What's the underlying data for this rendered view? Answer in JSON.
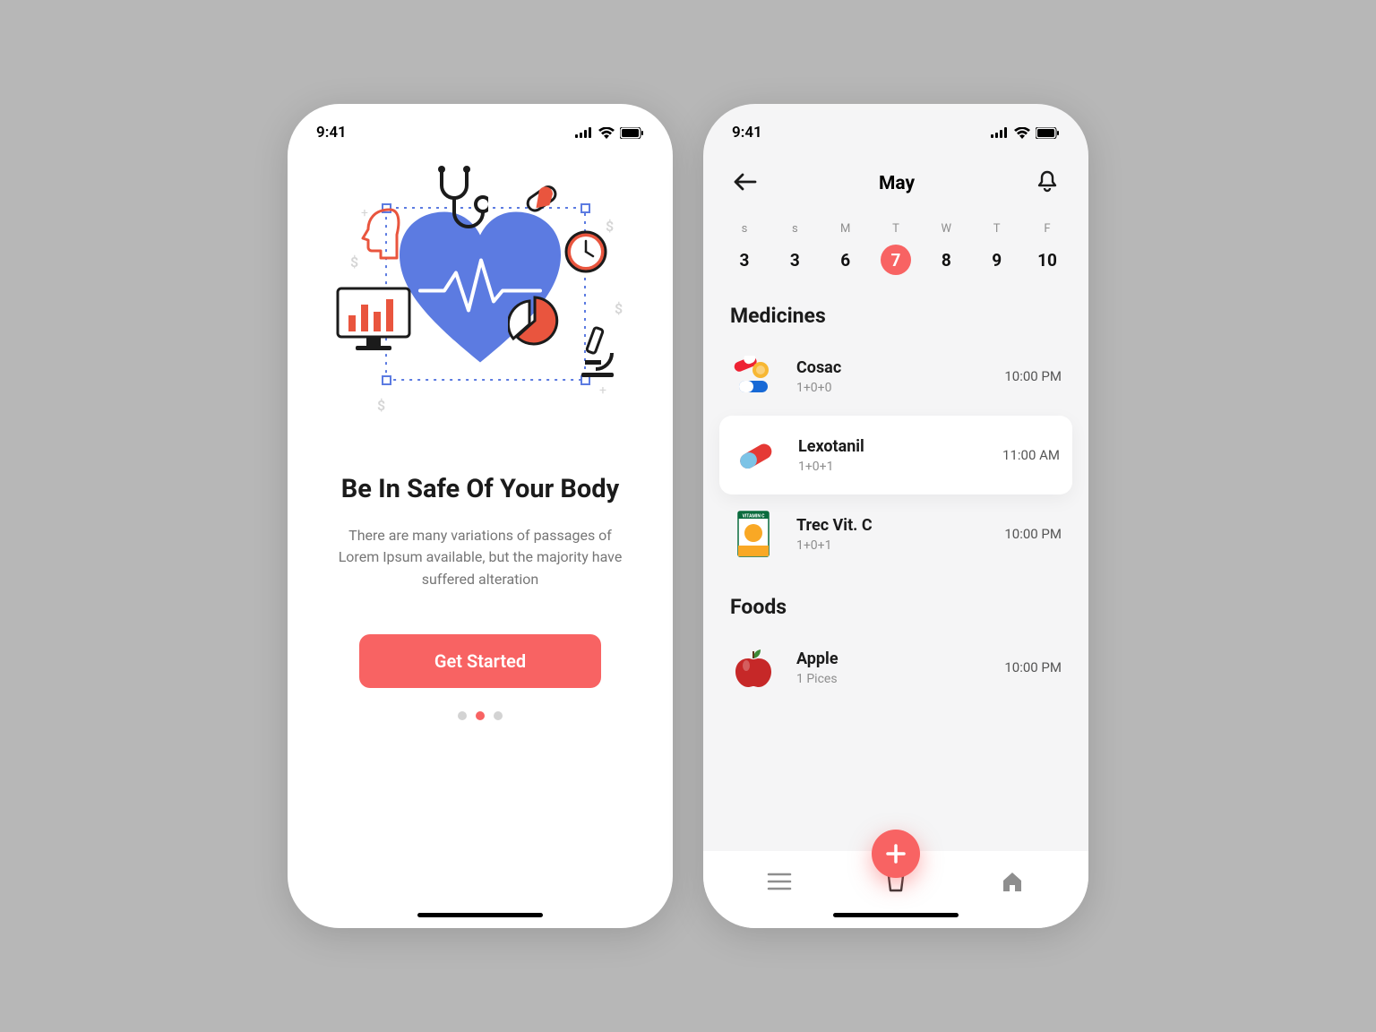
{
  "status": {
    "time": "9:41"
  },
  "colors": {
    "accent": "#f86363",
    "heart": "#5c7be1"
  },
  "onboarding": {
    "title": "Be In Safe Of Your Body",
    "description": "There are many variations of passages of Lorem Ipsum available, but the majority have suffered alteration",
    "cta": "Get Started",
    "page_index": 1,
    "page_count": 3
  },
  "calendar": {
    "month": "May",
    "days": [
      {
        "label": "s",
        "num": "3"
      },
      {
        "label": "s",
        "num": "3"
      },
      {
        "label": "M",
        "num": "6"
      },
      {
        "label": "T",
        "num": "7",
        "selected": true
      },
      {
        "label": "W",
        "num": "8"
      },
      {
        "label": "T",
        "num": "9"
      },
      {
        "label": "F",
        "num": "10"
      }
    ]
  },
  "sections": {
    "medicines_title": "Medicines",
    "foods_title": "Foods"
  },
  "medicines": [
    {
      "name": "Cosac",
      "sub": "1+0+0",
      "time": "10:00 PM",
      "icon": "pills-mixed"
    },
    {
      "name": "Lexotanil",
      "sub": "1+0+1",
      "time": "11:00 AM",
      "icon": "capsule",
      "highlighted": true
    },
    {
      "name": "Trec Vit. C",
      "sub": "1+0+1",
      "time": "10:00 PM",
      "icon": "vitamin-box"
    }
  ],
  "foods": [
    {
      "name": "Apple",
      "sub": "1 Pices",
      "time": "10:00 PM",
      "icon": "apple"
    }
  ]
}
